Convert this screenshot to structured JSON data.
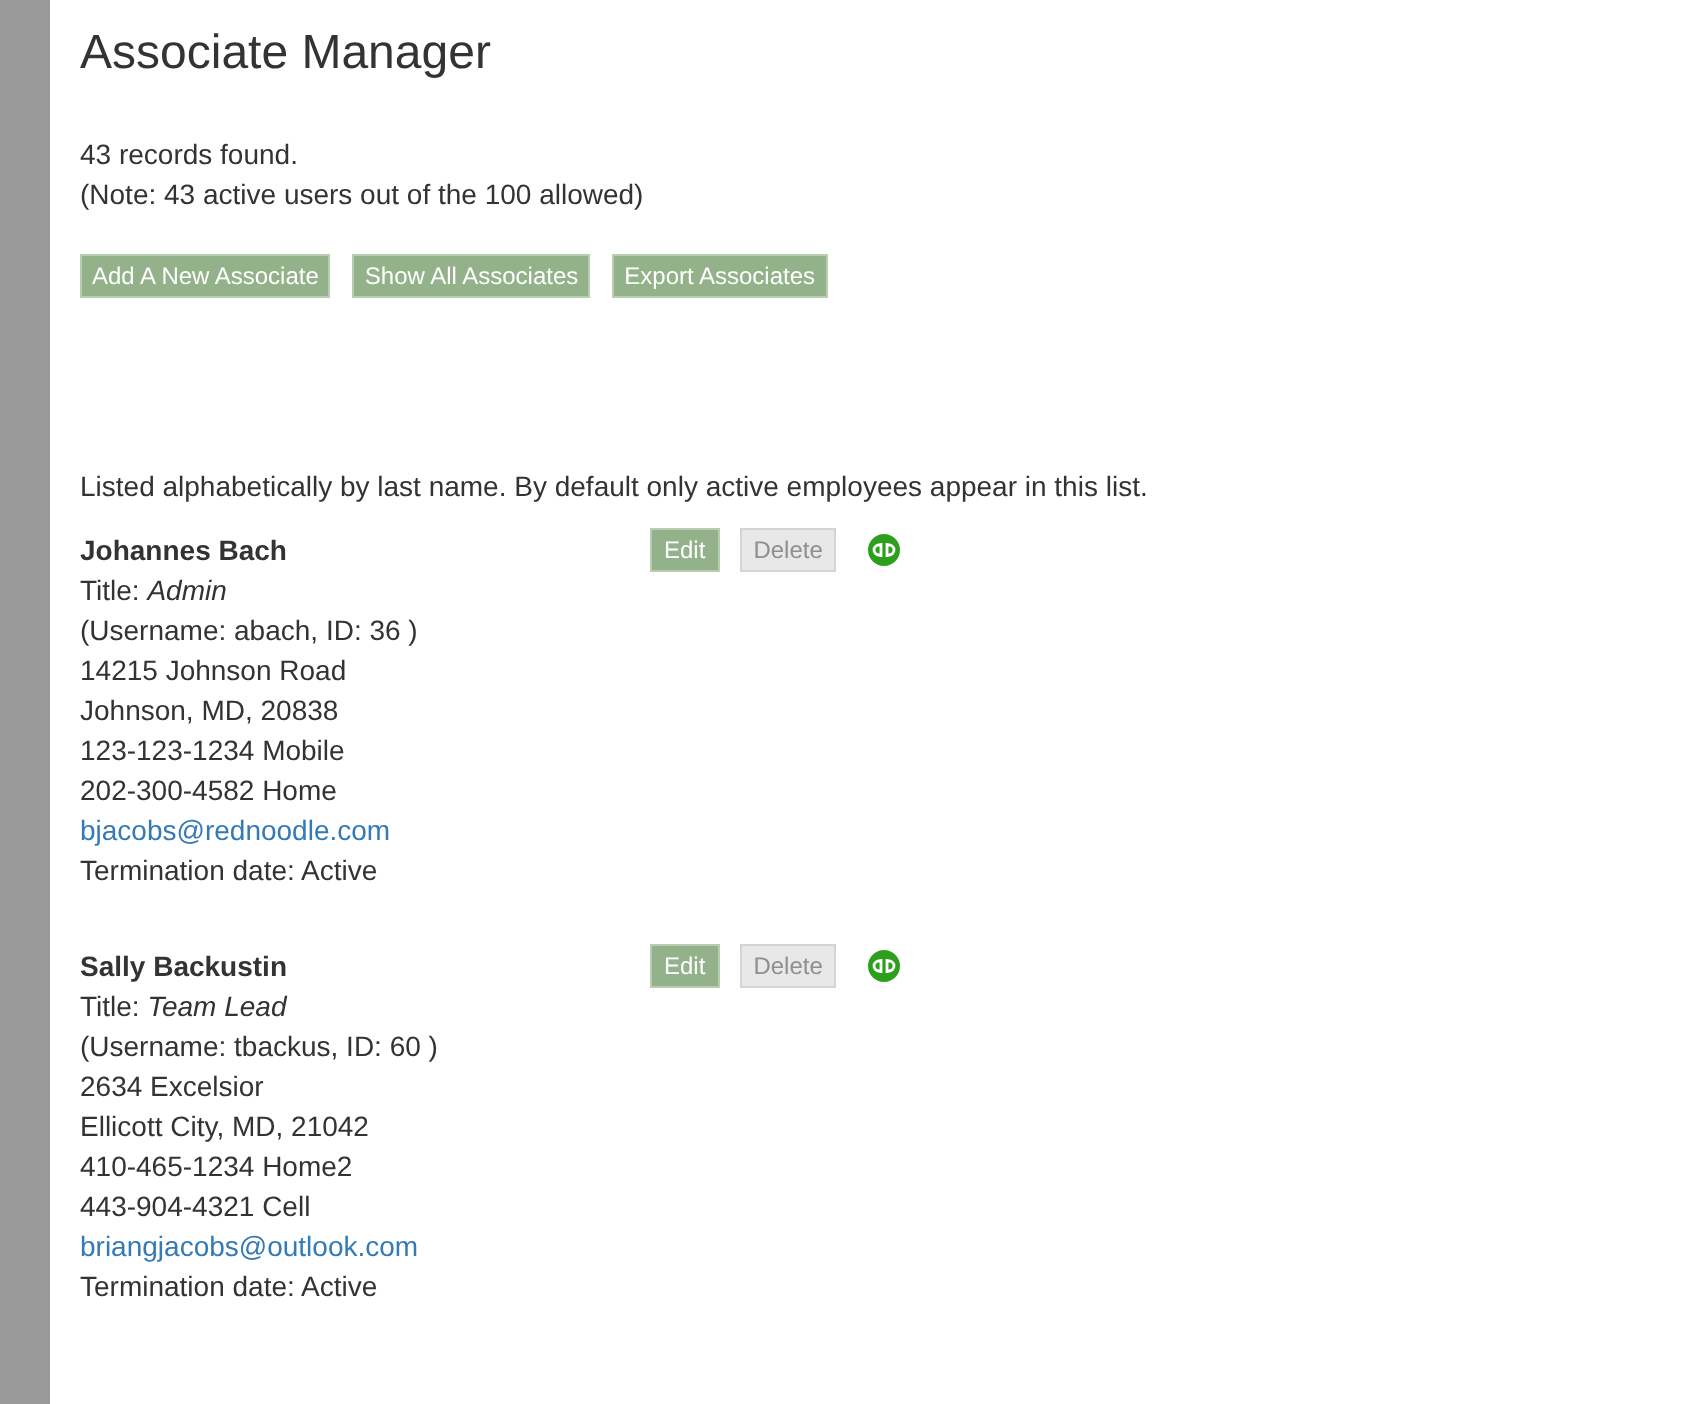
{
  "page": {
    "title": "Associate Manager"
  },
  "summary": [
    "43 records found.",
    "(Note: 43 active users out of the 100 allowed)"
  ],
  "actions": [
    {
      "label": "Add A New Associate"
    },
    {
      "label": "Show All Associates"
    },
    {
      "label": "Export Associates"
    }
  ],
  "note": "Listed alphabetically by last name. By default only active employees appear in this list.",
  "associates": [
    {
      "name": "Johannes Bach",
      "lines": [
        "Title: *Admin*",
        "(Username: abach, ID: 36 )",
        "14215 Johnson Road",
        "Johnson, MD, 20838",
        "123-123-1234 Mobile",
        "202-300-4582 Home"
      ],
      "email": "bjacobs@rednoodle.com",
      "termination": "Termination date: Active",
      "buttons": [
        {
          "label": "Edit",
          "disabled": false
        },
        {
          "label": "Delete",
          "disabled": true
        }
      ]
    },
    {
      "name": "Sally Backustin",
      "lines": [
        "Title: *Team Lead*",
        "(Username: tbackus, ID: 60 )",
        "2634 Excelsior",
        "Ellicott City, MD, 21042",
        "410-465-1234 Home2",
        "443-904-4321 Cell"
      ],
      "email": "briangjacobs@outlook.com",
      "termination": "Termination date: Active",
      "buttons": [
        {
          "label": "Edit",
          "disabled": false
        },
        {
          "label": "Delete",
          "disabled": true
        }
      ]
    }
  ]
}
